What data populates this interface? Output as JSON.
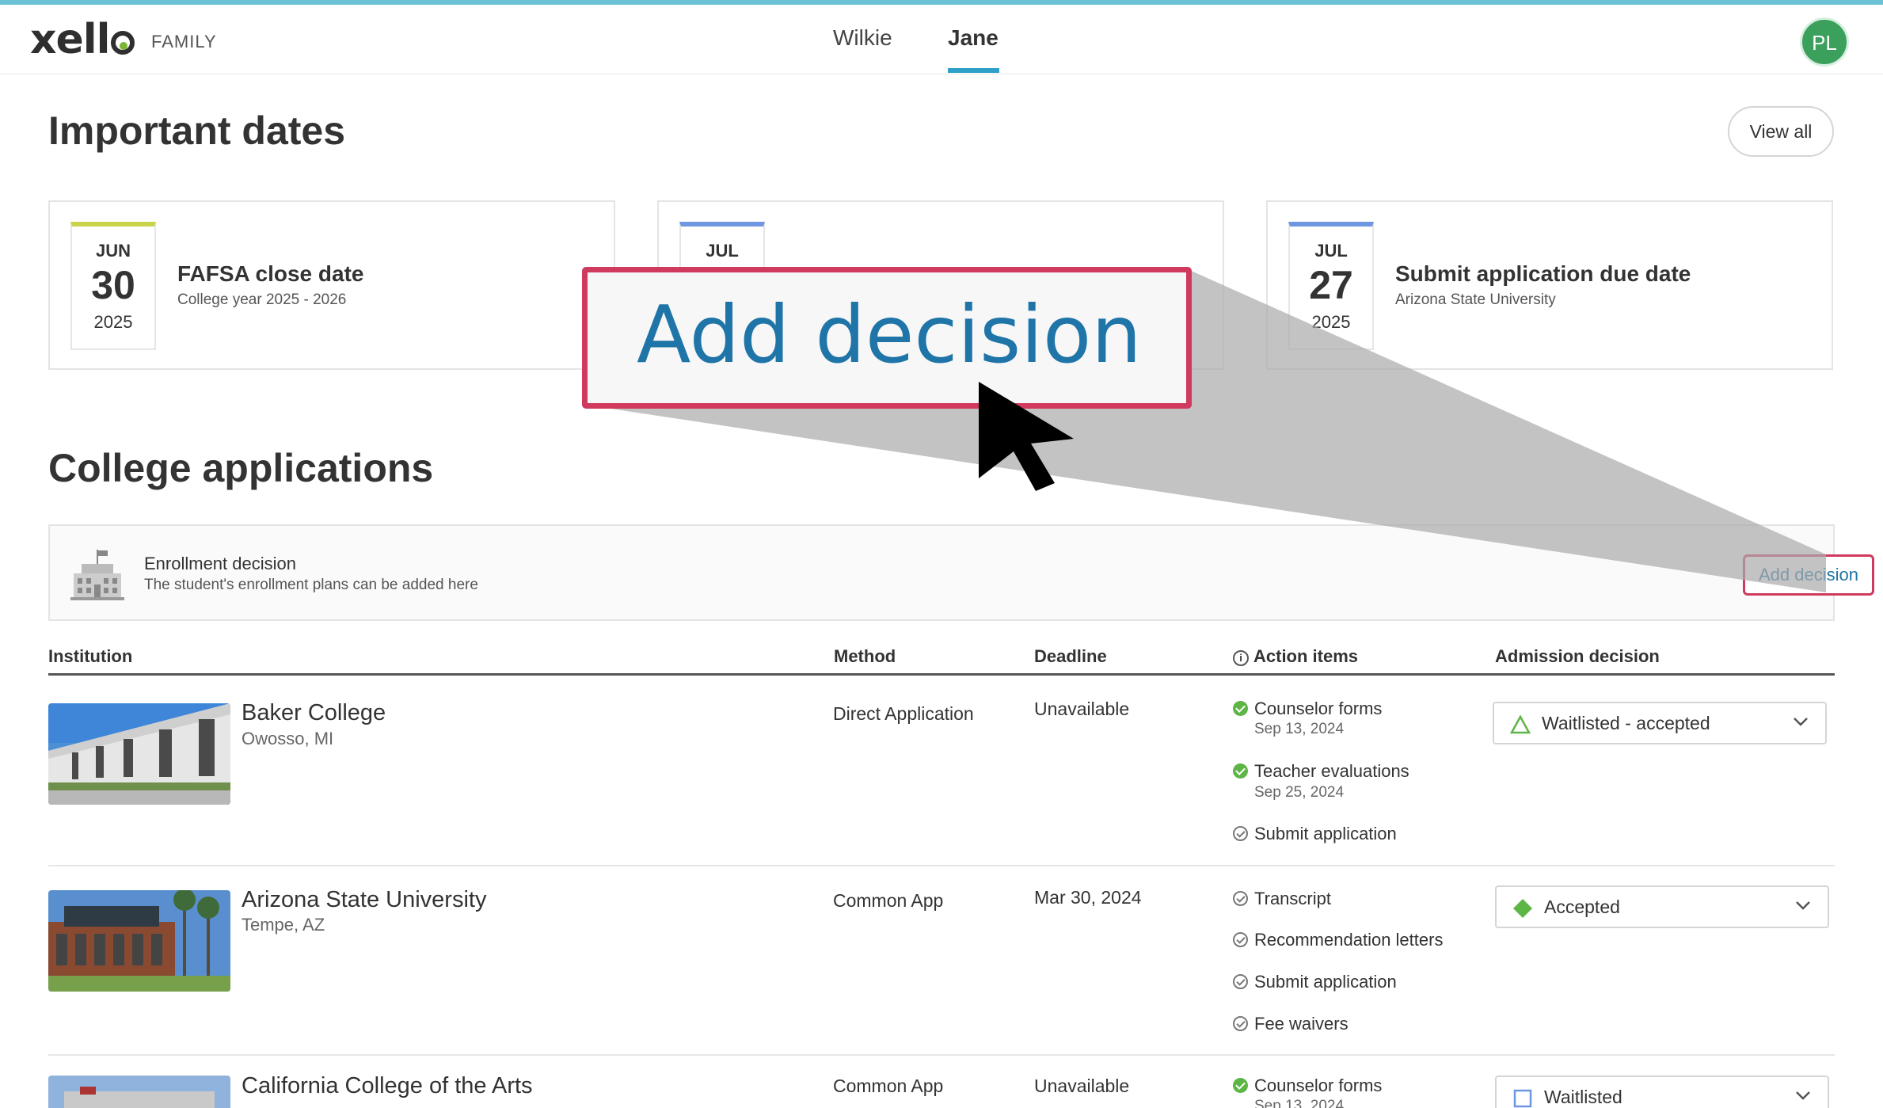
{
  "app": {
    "brand": "xello",
    "brand_suffix": "FAMILY",
    "accent_color": "#6cc3d5"
  },
  "header": {
    "tabs": [
      {
        "label": "Wilkie"
      },
      {
        "label": "Jane",
        "active": true
      }
    ],
    "avatar_initials": "PL"
  },
  "important_dates": {
    "title": "Important dates",
    "view_all_label": "View all",
    "cards": [
      {
        "month": "JUN",
        "day": "30",
        "year": "2025",
        "title": "FAFSA close date",
        "subtitle": "College year 2025 - 2026"
      },
      {
        "month": "JUL",
        "day": "",
        "year": "",
        "title": "",
        "subtitle": ""
      },
      {
        "month": "JUL",
        "day": "27",
        "year": "2025",
        "title": "Submit application due date",
        "subtitle": "Arizona State University"
      }
    ]
  },
  "college_applications": {
    "title": "College applications",
    "enrollment": {
      "title": "Enrollment decision",
      "subtitle": "The student's enrollment plans can be added here",
      "button_label": "Add decision"
    },
    "columns": [
      "Institution",
      "Method",
      "Deadline",
      "Action items",
      "Admission decision"
    ],
    "rows": [
      {
        "name": "Baker College",
        "location": "Owosso, MI",
        "method": "Direct Application",
        "deadline": "Unavailable",
        "action_items": [
          {
            "label": "Counselor forms",
            "date": "Sep 13, 2024",
            "done": true
          },
          {
            "label": "Teacher evaluations",
            "date": "Sep 25, 2024",
            "done": true
          },
          {
            "label": "Submit application",
            "date": "",
            "done": false
          }
        ],
        "decision": "Waitlisted - accepted",
        "decision_icon": "triangle-icon"
      },
      {
        "name": "Arizona State University",
        "location": "Tempe, AZ",
        "method": "Common App",
        "deadline": "Mar 30, 2024",
        "action_items": [
          {
            "label": "Transcript",
            "done": false
          },
          {
            "label": "Recommendation letters",
            "done": false
          },
          {
            "label": "Submit application",
            "done": false
          },
          {
            "label": "Fee waivers",
            "done": false
          }
        ],
        "decision": "Accepted",
        "decision_icon": "diamond-icon"
      },
      {
        "name": "California College of the Arts",
        "location": "",
        "method": "Common App",
        "deadline": "Unavailable",
        "action_items": [
          {
            "label": "Counselor forms",
            "date": "Sep 13, 2024",
            "done": true
          }
        ],
        "decision": "Waitlisted",
        "decision_icon": "square-icon"
      }
    ]
  },
  "zoom_callout": {
    "text": "Add decision",
    "border_color": "#d03a5e"
  }
}
